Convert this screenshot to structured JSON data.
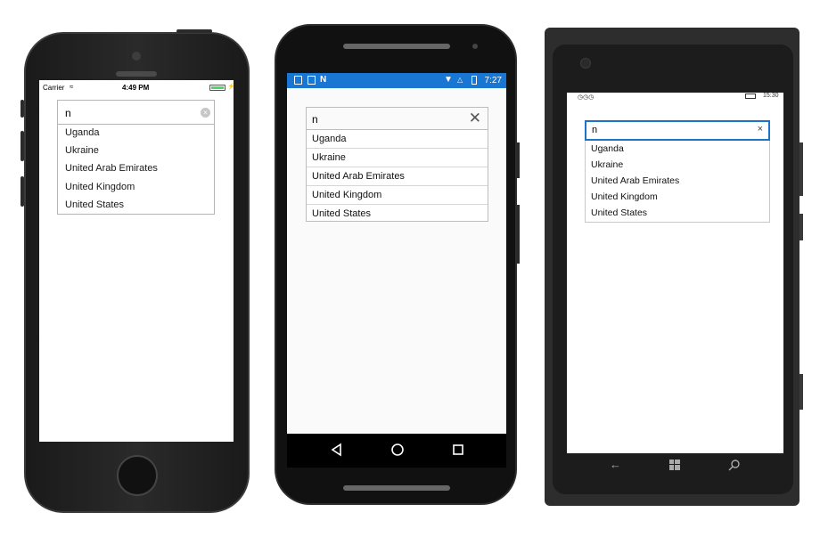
{
  "ios": {
    "carrier": "Carrier",
    "time": "4:49 PM",
    "search_value": "n",
    "clear_icon": "clear-circle-icon",
    "suggestions": [
      "Uganda",
      "Ukraine",
      "United Arab Emirates",
      "United Kingdom",
      "United States"
    ]
  },
  "android": {
    "time": "7:27",
    "search_value": "n",
    "close_icon": "close-icon",
    "suggestions": [
      "Uganda",
      "Ukraine",
      "United Arab Emirates",
      "United Kingdom",
      "United States"
    ],
    "status_bar_color": "#1976d2"
  },
  "windows": {
    "time": "15:30",
    "search_value": "n",
    "close_icon": "close-icon",
    "suggestions": [
      "Uganda",
      "Ukraine",
      "United Arab Emirates",
      "United Kingdom",
      "United States"
    ],
    "accent_color": "#1e73c9"
  }
}
